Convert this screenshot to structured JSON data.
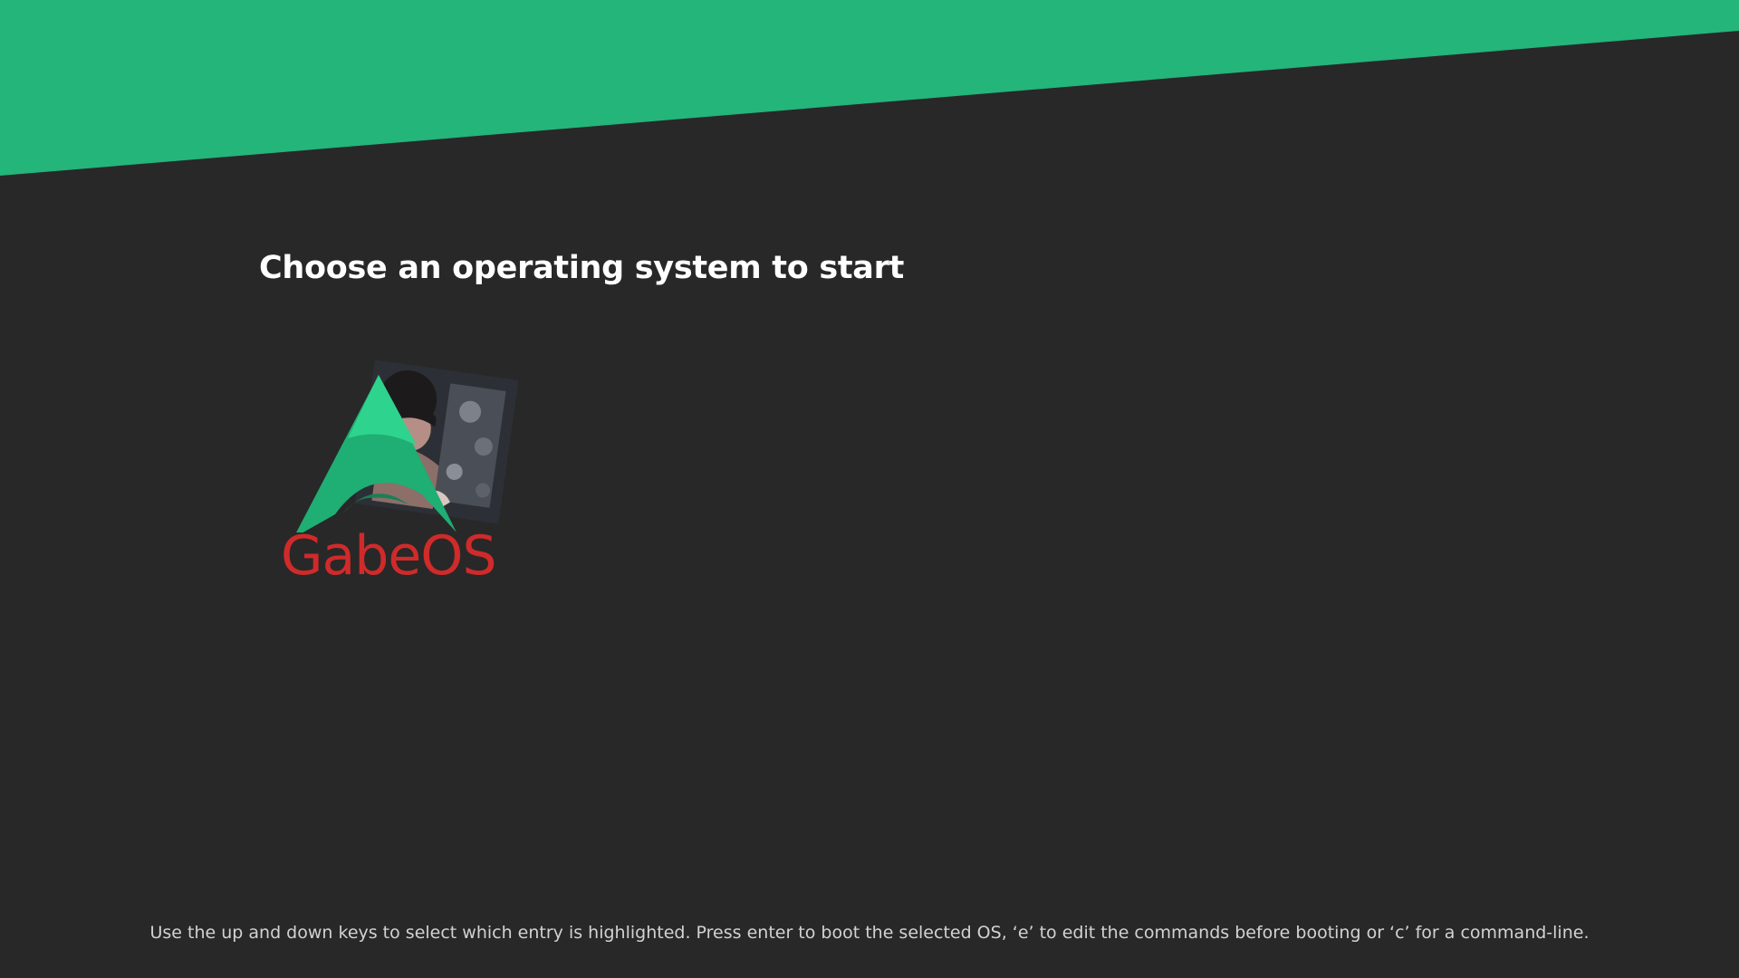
{
  "colors": {
    "background": "#282828",
    "accent": "#23b57a",
    "heading": "#ffffff",
    "help_text": "#d2d2d2",
    "os_label": "#d02a2a"
  },
  "boot_menu": {
    "heading": "Choose an operating system to start",
    "entries": [
      {
        "label": "GabeOS",
        "icon": "gabeos-logo-icon",
        "selected": true
      }
    ],
    "help_text": "Use the up and down keys to select which entry is highlighted. Press enter to boot the selected OS, ‘e’ to edit the commands before booting or ‘c’ for a command-line."
  }
}
